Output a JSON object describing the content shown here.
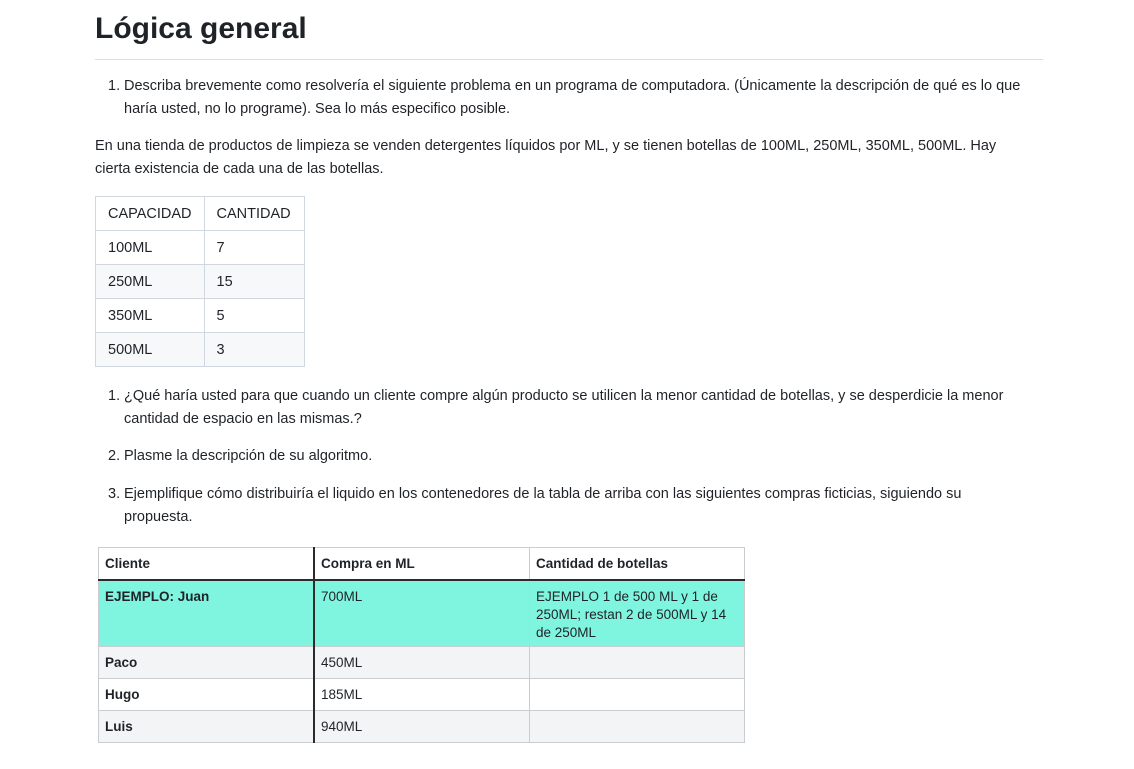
{
  "title": "Lógica general",
  "intro_item": {
    "number": "1.",
    "text": "Describa brevemente como resolvería el siguiente problema en un programa de computadora. (Únicamente la descripción de qué es lo que haría usted, no lo programe). Sea lo más especifico posible."
  },
  "paragraph": "En una tienda de productos de limpieza se venden detergentes líquidos por ML, y se tienen botellas de 100ML, 250ML, 350ML, 500ML. Hay cierta existencia de cada una de las botellas.",
  "stock_table": {
    "headers": [
      "CAPACIDAD",
      "CANTIDAD"
    ],
    "rows": [
      [
        "100ML",
        "7"
      ],
      [
        "250ML",
        "15"
      ],
      [
        "350ML",
        "5"
      ],
      [
        "500ML",
        "3"
      ]
    ]
  },
  "questions": [
    {
      "number": "1.",
      "text": "¿Qué haría usted para que cuando un cliente compre algún producto se utilicen la menor cantidad de botellas, y se desperdicie la menor cantidad de espacio en las mismas.?"
    },
    {
      "number": "2.",
      "text": "Plasme la descripción de su algoritmo."
    },
    {
      "number": "3.",
      "text": "Ejemplifique cómo distribuiría el liquido en los contenedores de la tabla de arriba con las siguientes compras ficticias, siguiendo su propuesta."
    }
  ],
  "purchase_table": {
    "headers": [
      "Cliente",
      "Compra en ML",
      "Cantidad de botellas"
    ],
    "example_row": [
      "EJEMPLO: Juan",
      "700ML",
      "EJEMPLO 1 de 500 ML y 1 de 250ML; restan 2 de 500ML y 14 de 250ML"
    ],
    "rows": [
      [
        "Paco",
        "450ML",
        ""
      ],
      [
        "Hugo",
        "185ML",
        ""
      ],
      [
        "Luis",
        "940ML",
        ""
      ]
    ],
    "highlight_color": "#7ff5df"
  }
}
